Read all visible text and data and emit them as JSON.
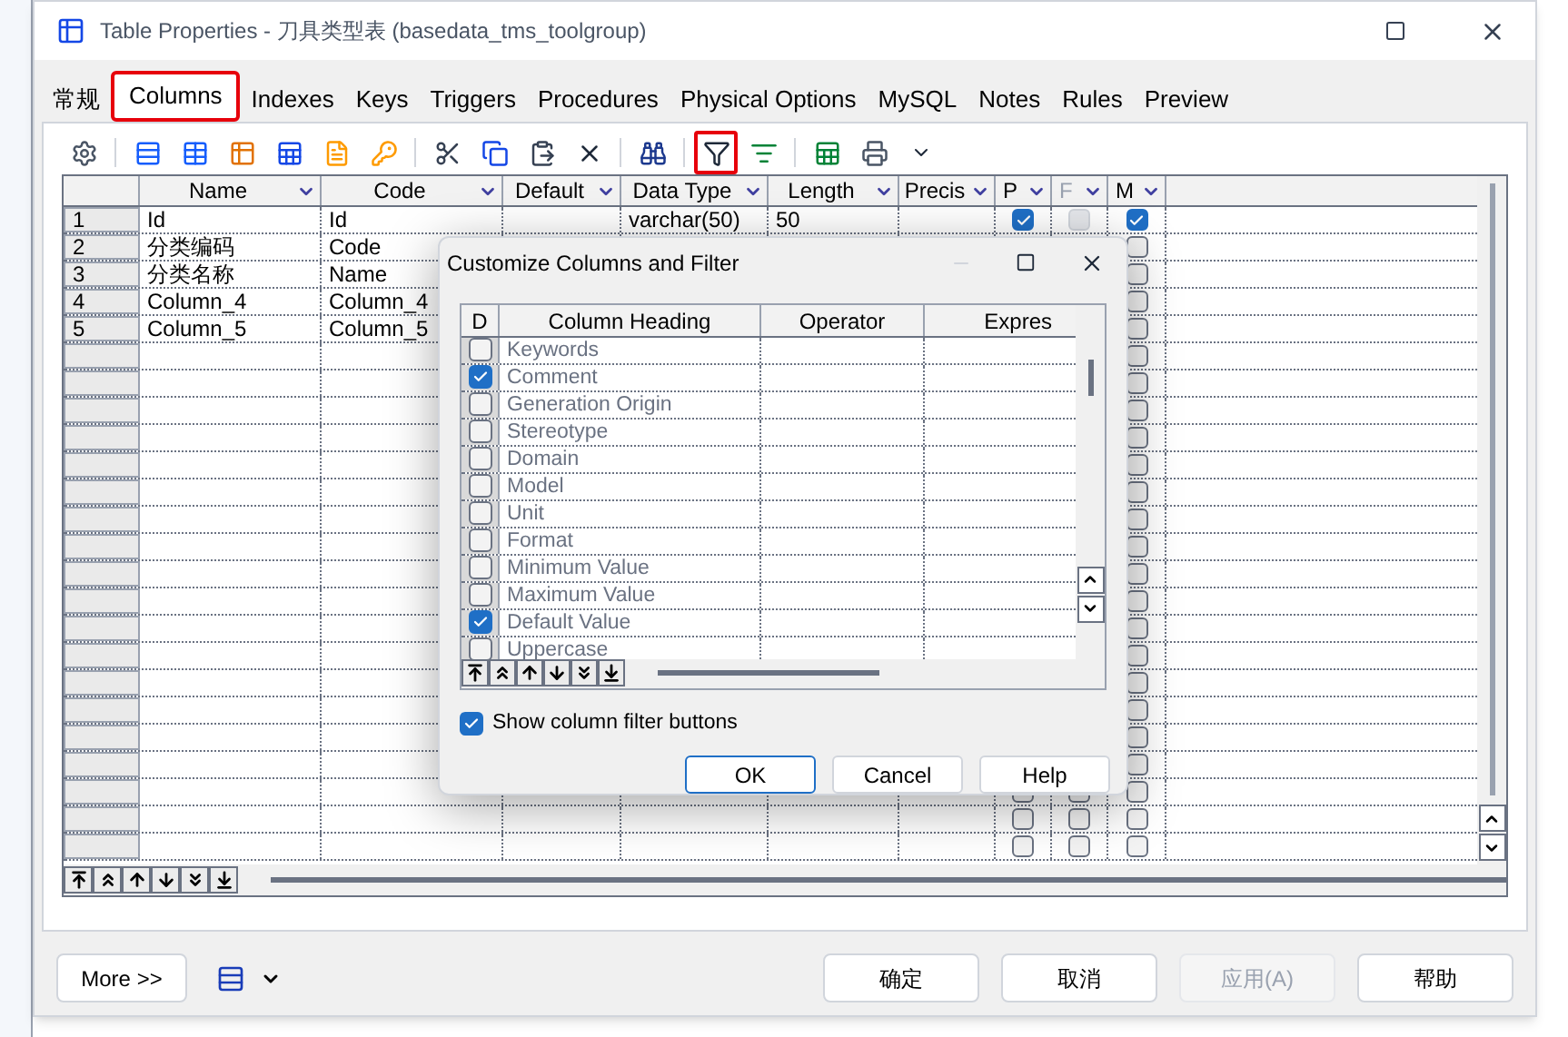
{
  "window": {
    "title": "Table Properties - 刀具类型表 (basedata_tms_toolgroup)"
  },
  "tabs": [
    {
      "label": "常规",
      "selected": false,
      "highlighted": false
    },
    {
      "label": "Columns",
      "selected": true,
      "highlighted": true
    },
    {
      "label": "Indexes",
      "selected": false,
      "highlighted": false
    },
    {
      "label": "Keys",
      "selected": false,
      "highlighted": false
    },
    {
      "label": "Triggers",
      "selected": false,
      "highlighted": false
    },
    {
      "label": "Procedures",
      "selected": false,
      "highlighted": false
    },
    {
      "label": "Physical Options",
      "selected": false,
      "highlighted": false
    },
    {
      "label": "MySQL",
      "selected": false,
      "highlighted": false
    },
    {
      "label": "Notes",
      "selected": false,
      "highlighted": false
    },
    {
      "label": "Rules",
      "selected": false,
      "highlighted": false
    },
    {
      "label": "Preview",
      "selected": false,
      "highlighted": false
    }
  ],
  "toolbar": [
    {
      "kind": "properties",
      "highlighted": false
    },
    {
      "kind": "separator"
    },
    {
      "kind": "insert-row",
      "highlighted": false
    },
    {
      "kind": "add-row",
      "highlighted": false
    },
    {
      "kind": "add-domain",
      "highlighted": false
    },
    {
      "kind": "add-columns",
      "highlighted": false
    },
    {
      "kind": "document",
      "highlighted": false
    },
    {
      "kind": "key",
      "highlighted": false
    },
    {
      "kind": "separator"
    },
    {
      "kind": "cut",
      "highlighted": false
    },
    {
      "kind": "copy",
      "highlighted": false
    },
    {
      "kind": "paste",
      "highlighted": false
    },
    {
      "kind": "delete",
      "highlighted": false
    },
    {
      "kind": "separator"
    },
    {
      "kind": "find",
      "highlighted": false
    },
    {
      "kind": "separator"
    },
    {
      "kind": "filter",
      "highlighted": true
    },
    {
      "kind": "customize",
      "highlighted": false
    },
    {
      "kind": "separator"
    },
    {
      "kind": "excel",
      "highlighted": false
    },
    {
      "kind": "print",
      "highlighted": false
    },
    {
      "kind": "dropdown",
      "highlighted": false
    }
  ],
  "grid": {
    "columns": [
      {
        "label": "Name",
        "dimmed": false
      },
      {
        "label": "Code",
        "dimmed": false
      },
      {
        "label": "Default",
        "dimmed": false
      },
      {
        "label": "Data Type",
        "dimmed": false
      },
      {
        "label": "Length",
        "dimmed": false
      },
      {
        "label": "Precis",
        "dimmed": false
      },
      {
        "label": "P",
        "dimmed": false
      },
      {
        "label": "F",
        "dimmed": true
      },
      {
        "label": "M",
        "dimmed": false
      }
    ],
    "rows": [
      {
        "number": "1",
        "cells": [
          "Id",
          "Id",
          "",
          "varchar(50)",
          "50"
        ],
        "p": true,
        "f": false,
        "m": true
      },
      {
        "number": "2",
        "cells": [
          "分类编码",
          "Code"
        ],
        "m": false
      },
      {
        "number": "3",
        "cells": [
          "分类名称",
          "Name"
        ],
        "m": false
      },
      {
        "number": "4",
        "cells": [
          "Column_4",
          "Column_4"
        ],
        "m": false
      },
      {
        "number": "5",
        "cells": [
          "Column_5",
          "Column_5"
        ],
        "m": false
      }
    ],
    "blank_rows": [
      {
        "m": false
      },
      {
        "m": false
      },
      {
        "m": false
      },
      {
        "m": false
      },
      {
        "m": false
      },
      {
        "m": false
      },
      {
        "m": false
      },
      {
        "m": false
      },
      {
        "m": false
      },
      {
        "m": false
      },
      {
        "m": false
      },
      {
        "m": false
      },
      {
        "m": false
      },
      {
        "m": false
      },
      {
        "m": false
      },
      {
        "m": false
      },
      {
        "p": false,
        "f": false,
        "m": false
      },
      {
        "p": false,
        "f": false,
        "m": false
      },
      {
        "p": false,
        "f": false,
        "m": false
      }
    ]
  },
  "dialog": {
    "title": "Customize Columns and Filter",
    "columns": [
      "D",
      "Column Heading",
      "Operator",
      "Expres"
    ],
    "items": [
      {
        "label": "Keywords",
        "checked": false
      },
      {
        "label": "Comment",
        "checked": true
      },
      {
        "label": "Generation Origin",
        "checked": false
      },
      {
        "label": "Stereotype",
        "checked": false
      },
      {
        "label": "Domain",
        "checked": false
      },
      {
        "label": "Model",
        "checked": false
      },
      {
        "label": "Unit",
        "checked": false
      },
      {
        "label": "Format",
        "checked": false
      },
      {
        "label": "Minimum Value",
        "checked": false
      },
      {
        "label": "Maximum Value",
        "checked": false
      },
      {
        "label": "Default Value",
        "checked": true
      },
      {
        "label": "Uppercase",
        "checked": false
      }
    ],
    "show_filter_buttons": {
      "label": "Show column filter buttons",
      "checked": true
    },
    "buttons": [
      {
        "label": "OK",
        "default": true
      },
      {
        "label": "Cancel",
        "default": false
      },
      {
        "label": "Help",
        "default": false
      }
    ]
  },
  "footer": {
    "more_button": "More >>",
    "buttons": [
      {
        "label": "确定",
        "disabled": false
      },
      {
        "label": "取消",
        "disabled": false
      },
      {
        "label": "应用(A)",
        "disabled": true
      },
      {
        "label": "帮助",
        "disabled": false
      }
    ]
  }
}
